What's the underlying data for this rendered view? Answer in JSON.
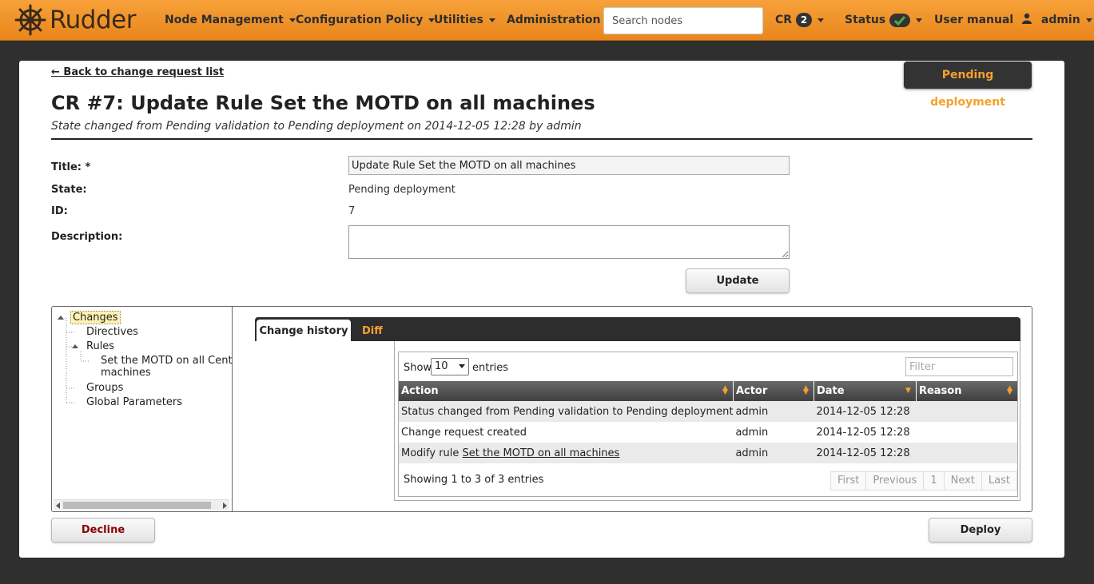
{
  "nav": {
    "logo_text": "Rudder",
    "items": [
      {
        "label": "Node Management"
      },
      {
        "label": "Configuration Policy"
      },
      {
        "label": "Utilities"
      },
      {
        "label": "Administration"
      }
    ],
    "search_placeholder": "Search nodes",
    "cr_label": "CR",
    "cr_count": "2",
    "status_label": "Status",
    "manual_label": "User manual",
    "user_label": "admin",
    "accent_color": "#f29430"
  },
  "page": {
    "back_link": "← Back to change request list",
    "state_badge": "Pending deployment",
    "title": "CR #7: Update Rule Set the MOTD on all machines",
    "subtitle": "State changed from Pending validation to Pending deployment on 2014-12-05 12:28 by admin"
  },
  "form": {
    "title_label": "Title: *",
    "title_value": "Update Rule Set the MOTD on all machines",
    "state_label": "State:",
    "state_value": "Pending deployment",
    "id_label": "ID:",
    "id_value": "7",
    "description_label": "Description:",
    "description_value": "",
    "update_button": "Update"
  },
  "tree": {
    "root": "Changes",
    "directives": "Directives",
    "rules": "Rules",
    "rule_item_line1": "Set the MOTD on all CentOS",
    "rule_item_line2": "machines",
    "groups": "Groups",
    "global_parameters": "Global Parameters"
  },
  "tabs": {
    "history": "Change history",
    "diff": "Diff"
  },
  "table": {
    "show_label": "Show",
    "page_length": "10",
    "entries_label": "entries",
    "filter_placeholder": "Filter",
    "columns": [
      "Action",
      "Actor",
      "Date",
      "Reason"
    ],
    "rows": [
      {
        "action": "Status changed from Pending validation to Pending deployment",
        "actor": "admin",
        "date": "2014-12-05 12:28",
        "reason": ""
      },
      {
        "action": "Change request created",
        "actor": "admin",
        "date": "2014-12-05 12:28",
        "reason": ""
      },
      {
        "action_prefix": "Modify rule ",
        "action_link": "Set the MOTD on all machines",
        "actor": "admin",
        "date": "2014-12-05 12:28",
        "reason": ""
      }
    ],
    "info": "Showing 1 to 3 of 3 entries",
    "pager": {
      "first": "First",
      "previous": "Previous",
      "page": "1",
      "next": "Next",
      "last": "Last"
    }
  },
  "actions": {
    "decline": "Decline",
    "deploy": "Deploy"
  }
}
